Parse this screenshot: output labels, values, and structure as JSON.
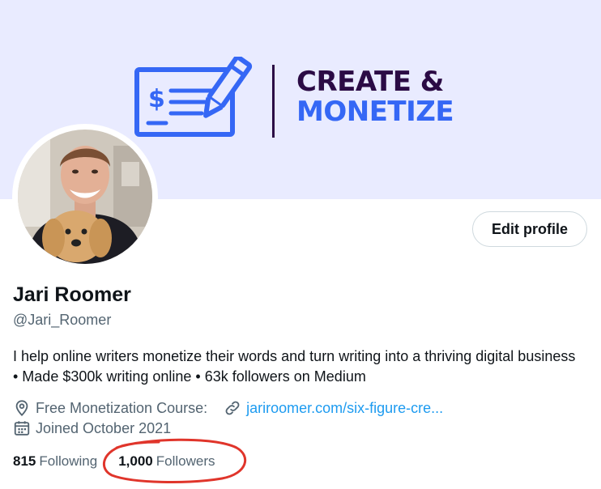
{
  "banner": {
    "line1": "CREATE &",
    "line2": "MONETIZE",
    "check_icon": "dollar-check-icon",
    "pen_icon": "pen-icon",
    "colors": {
      "background": "#e9ebff",
      "dark": "#2b0b45",
      "blue": "#3567f5"
    }
  },
  "avatar": {
    "description_icon": "avatar"
  },
  "profile": {
    "edit_button": "Edit profile",
    "name": "Jari Roomer",
    "handle": "@Jari_Roomer",
    "bio": "I help online writers monetize their words and turn writing into a thriving digital business • Made $300k writing online • 63k followers on Medium",
    "location_icon": "location-pin-icon",
    "location": "Free Monetization Course:",
    "link_icon": "link-icon",
    "link": "jariroomer.com/six-figure-cre...",
    "calendar_icon": "calendar-icon",
    "joined": "Joined October 2021"
  },
  "stats": {
    "following_count": "815",
    "following_label": "Following",
    "followers_count": "1,000",
    "followers_label": "Followers",
    "annotation_color": "#e0352b"
  },
  "colors": {
    "text": "#0f1419",
    "muted": "#536471",
    "link": "#1d9bf0"
  }
}
